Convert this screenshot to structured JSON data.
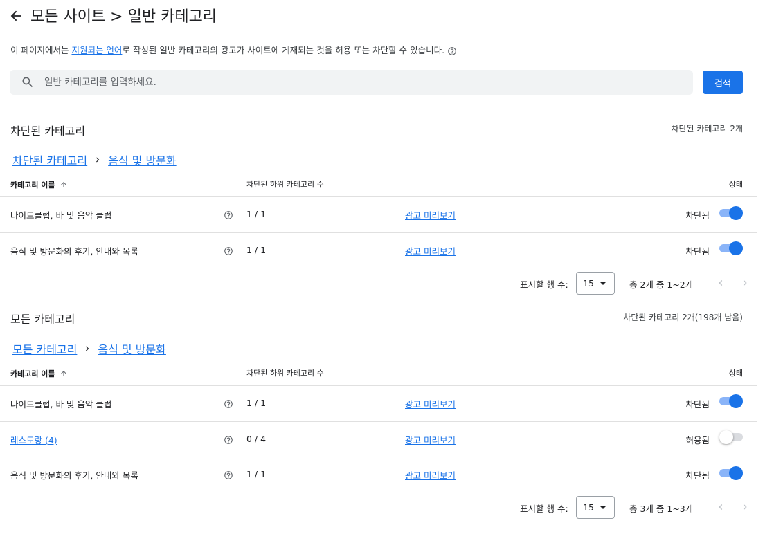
{
  "header": {
    "title": "모든 사이트 > 일반 카테고리",
    "back_icon": "arrow-back-icon"
  },
  "description": {
    "before": "이 페이지에서는 ",
    "link": "지원되는 언어",
    "after": "로 작성된 일반 카테고리의 광고가 사이트에 게재되는 것을 허용 또는 차단할 수 있습니다."
  },
  "search": {
    "placeholder": "일반 카테고리를 입력하세요.",
    "button_label": "검색"
  },
  "colors": {
    "accent": "#1a73e8",
    "toggle_track_on": "#8ab4f8",
    "divider": "#e0e0e0"
  },
  "blocked_section": {
    "title": "차단된 카테고리",
    "count": "차단된 카테고리 2개",
    "breadcrumb": [
      "차단된 카테고리",
      "음식 및 방문화"
    ],
    "columns": {
      "name": "카테고리 이름",
      "subcount": "차단된 하위 카테고리 수",
      "status": "상태"
    },
    "rows": [
      {
        "name": "나이트클럽, 바 및 음악 클럽",
        "count": "1 / 1",
        "preview": "광고 미리보기",
        "status": "차단됨",
        "on": true
      },
      {
        "name": "음식 및 방문화의 후기, 안내와 목록",
        "count": "1 / 1",
        "preview": "광고 미리보기",
        "status": "차단됨",
        "on": true
      }
    ],
    "pagination": {
      "rows_label": "표시할 행 수:",
      "rows_value": "15",
      "range": "총 2개 중 1~2개"
    }
  },
  "all_section": {
    "title": "모든 카테고리",
    "count": "차단된 카테고리 2개(198개 남음)",
    "breadcrumb": [
      "모든 카테고리",
      "음식 및 방문화"
    ],
    "columns": {
      "name": "카테고리 이름",
      "subcount": "차단된 하위 카테고리 수",
      "status": "상태"
    },
    "rows": [
      {
        "name": "나이트클럽, 바 및 음악 클럽",
        "count": "1 / 1",
        "preview": "광고 미리보기",
        "status": "차단됨",
        "on": true
      },
      {
        "name": "레스토랑 (4)",
        "count": "0 / 4",
        "preview": "광고 미리보기",
        "status": "허용됨",
        "on": false
      },
      {
        "name": "음식 및 방문화의 후기, 안내와 목록",
        "count": "1 / 1",
        "preview": "광고 미리보기",
        "status": "차단됨",
        "on": true
      }
    ],
    "pagination": {
      "rows_label": "표시할 행 수:",
      "rows_value": "15",
      "range": "총 3개 중 1~3개"
    }
  }
}
